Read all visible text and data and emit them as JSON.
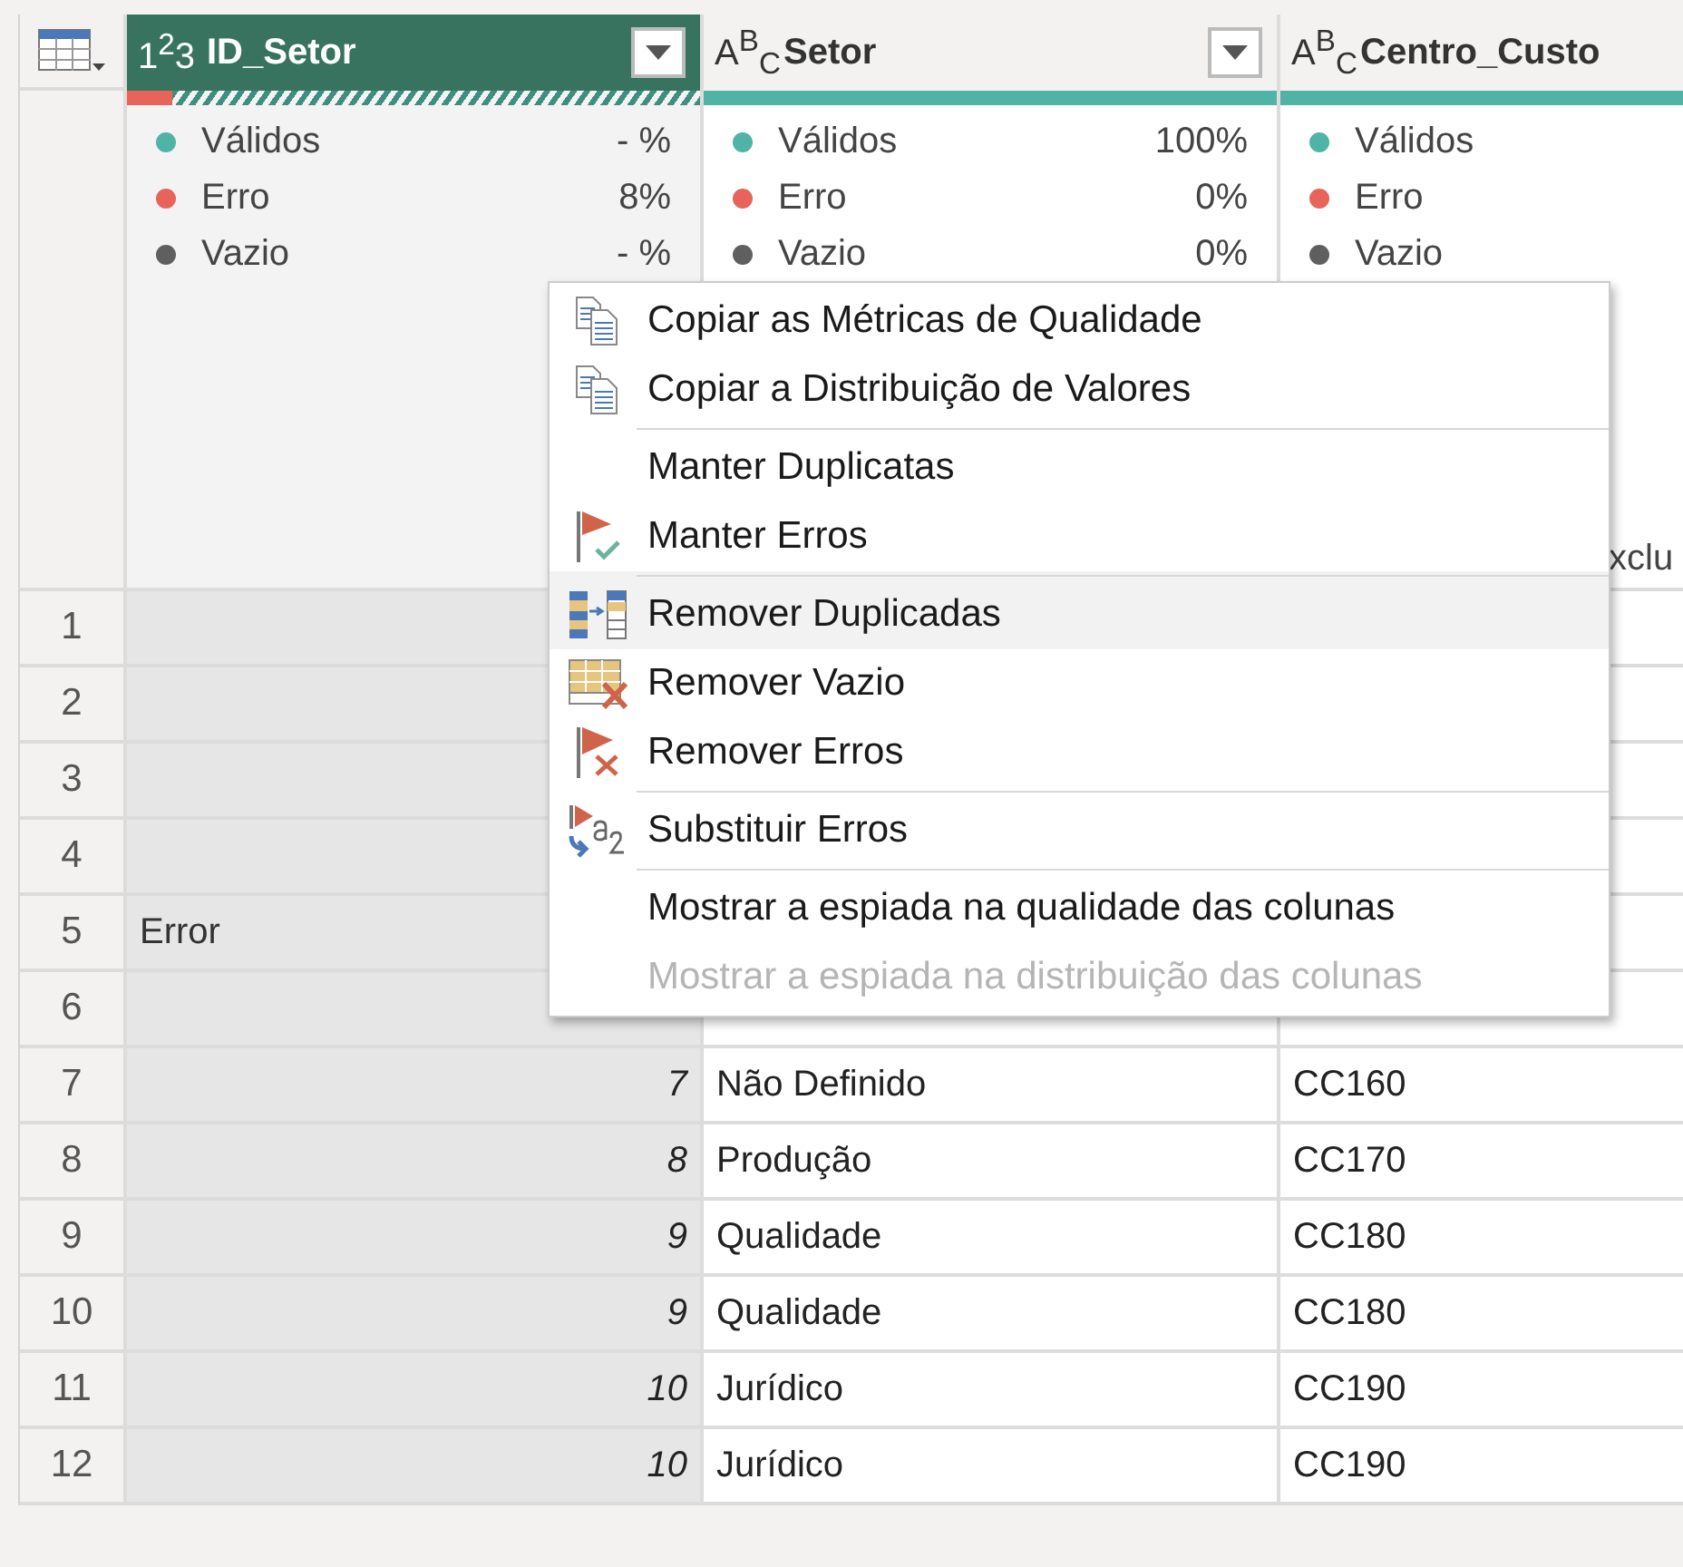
{
  "columns": [
    {
      "type_label": "1$^{2}$3",
      "name": "ID_Setor",
      "selected": true,
      "filter_button": true,
      "error_bar": {
        "level": 0.08
      },
      "hatched": true,
      "stats": [
        {
          "label": "Válidos",
          "value": "- %",
          "color": "#4fb3a6"
        },
        {
          "label": "Erro",
          "value": "8%",
          "color": "#e8645a"
        },
        {
          "label": "Vazio",
          "value": "- %",
          "color": "#5f5f5f"
        }
      ]
    },
    {
      "type_label": "A$^{B}$$_{C}$",
      "name": "Setor",
      "selected": false,
      "filter_button": true,
      "error_bar": {
        "level": 0
      },
      "hatched": false,
      "stats": [
        {
          "label": "Válidos",
          "value": "100%",
          "color": "#4fb3a6"
        },
        {
          "label": "Erro",
          "value": "0%",
          "color": "#e8645a"
        },
        {
          "label": "Vazio",
          "value": "0%",
          "color": "#5f5f5f"
        }
      ]
    },
    {
      "type_label": "A$^{B}$$_{C}$",
      "name": "Centro_Custo",
      "selected": false,
      "filter_button": false,
      "error_bar": {
        "level": 0
      },
      "hatched": false,
      "stats": [
        {
          "label": "Válidos",
          "color": "#4fb3a6"
        },
        {
          "label": "Erro",
          "color": "#e8645a"
        },
        {
          "label": "Vazio",
          "color": "#5f5f5f"
        }
      ],
      "footer": "xclu"
    }
  ],
  "rows": [
    {
      "num": "1"
    },
    {
      "num": "2"
    },
    {
      "num": "3"
    },
    {
      "num": "4"
    },
    {
      "num": "5",
      "id": "Error",
      "kind": "error"
    },
    {
      "num": "6"
    },
    {
      "num": "7",
      "id": "7",
      "setor": "Não Definido",
      "centro": "CC160",
      "kind": "value"
    },
    {
      "num": "8",
      "id": "8",
      "setor": "Produção",
      "centro": "CC170",
      "kind": "value"
    },
    {
      "num": "9",
      "id": "9",
      "setor": "Qualidade",
      "centro": "CC180",
      "kind": "value"
    },
    {
      "num": "10",
      "id": "9",
      "setor": "Qualidade",
      "centro": "CC180",
      "kind": "value"
    },
    {
      "num": "11",
      "id": "10",
      "setor": "Jurídico",
      "centro": "CC190",
      "kind": "value"
    },
    {
      "num": "12",
      "id": "10",
      "setor": "Jurídico",
      "centro": "CC190",
      "kind": "value"
    }
  ],
  "context_menu": [
    {
      "label": "Copiar as Métricas de Qualidade",
      "kind": "copy",
      "separator_before": false,
      "selected": false,
      "disabled": false
    },
    {
      "label": "Copiar a Distribuição de Valores",
      "kind": "copy",
      "separator_before": false,
      "selected": false,
      "disabled": false
    },
    {
      "label": "Manter Duplicatas",
      "kind": "plain",
      "separator_before": true,
      "selected": false,
      "disabled": false
    },
    {
      "label": "Manter Erros",
      "kind": "keep-errors",
      "separator_before": false,
      "selected": false,
      "disabled": false
    },
    {
      "label": "Remover Duplicadas",
      "kind": "remove-duplicates",
      "separator_before": true,
      "selected": true,
      "disabled": false
    },
    {
      "label": "Remover Vazio",
      "kind": "remove-empty",
      "separator_before": false,
      "selected": false,
      "disabled": false
    },
    {
      "label": "Remover Erros",
      "kind": "remove-errors",
      "separator_before": false,
      "selected": false,
      "disabled": false
    },
    {
      "label": "Substituir Erros",
      "kind": "replace-errors",
      "separator_before": true,
      "selected": false,
      "disabled": false
    },
    {
      "label": "Mostrar a espiada na qualidade das colunas",
      "kind": "plain",
      "separator_before": true,
      "selected": false,
      "disabled": false
    },
    {
      "label": "Mostrar a espiada na distribuição das colunas",
      "kind": "plain",
      "separator_before": false,
      "selected": false,
      "disabled": true
    }
  ]
}
